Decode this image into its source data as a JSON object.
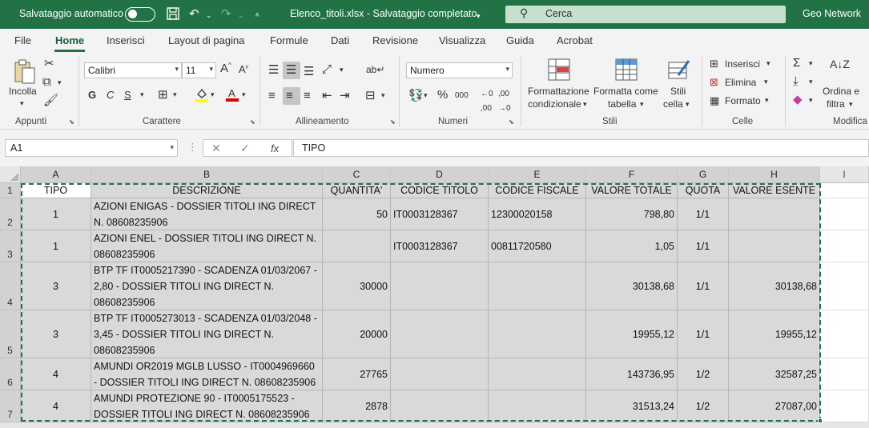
{
  "titlebar": {
    "autosave_label": "Salvataggio automatico",
    "autosave_on": false,
    "filename": "Elenco_titoli.xlsx  -  Salvataggio completato",
    "search_placeholder": "Cerca",
    "user": "Geo Network",
    "icons": [
      "save-icon",
      "undo-icon",
      "redo-icon",
      "customize-qat-icon"
    ]
  },
  "tabs": [
    "File",
    "Home",
    "Inserisci",
    "Layout di pagina",
    "Formule",
    "Dati",
    "Revisione",
    "Visualizza",
    "Guida",
    "Acrobat"
  ],
  "active_tab": "Home",
  "ribbon": {
    "clipboard": {
      "label": "Appunti",
      "paste": "Incolla"
    },
    "font": {
      "label": "Carattere",
      "name": "Calibri",
      "size": "11",
      "bold": "G",
      "italic": "C",
      "underline": "S"
    },
    "alignment": {
      "label": "Allineamento"
    },
    "number": {
      "label": "Numeri",
      "format": "Numero",
      "pct": "%",
      "thousands": "000"
    },
    "styles": {
      "label": "Stili",
      "cond_line1": "Formattazione",
      "cond_line2": "condizionale",
      "table_line1": "Formatta come",
      "table_line2": "tabella",
      "cell_line1": "Stili",
      "cell_line2": "cella"
    },
    "cells": {
      "label": "Celle",
      "insert": "Inserisci",
      "delete": "Elimina",
      "format": "Formato"
    },
    "editing": {
      "label": "Modifica",
      "sort_line1": "Ordina e",
      "sort_line2": "filtra"
    }
  },
  "formula_bar": {
    "cell_ref": "A1",
    "content": "TIPO",
    "fx": "fx"
  },
  "columns": [
    "A",
    "B",
    "C",
    "D",
    "E",
    "F",
    "G",
    "H",
    "I"
  ],
  "rows": [
    "1",
    "2",
    "3",
    "4",
    "5",
    "6",
    "7"
  ],
  "table": {
    "headers": [
      "TIPO",
      "DESCRIZIONE",
      "QUANTITA'",
      "CODICE TITOLO",
      "CODICE FISCALE",
      "VALORE TOTALE",
      "QUOTA",
      "VALORE ESENTE"
    ],
    "data": [
      [
        "1",
        "AZIONI ENIGAS - DOSSIER TITOLI ING DIRECT N. 08608235906",
        "50",
        "IT0003128367",
        "12300020158",
        "798,80",
        "1/1",
        ""
      ],
      [
        "1",
        "AZIONI ENEL - DOSSIER TITOLI ING DIRECT N. 08608235906",
        "",
        "IT0003128367",
        "00811720580",
        "1,05",
        "1/1",
        ""
      ],
      [
        "3",
        "BTP TF IT0005217390 - SCADENZA 01/03/2067 - 2,80 - DOSSIER TITOLI ING DIRECT N. 08608235906",
        "30000",
        "",
        "",
        "30138,68",
        "1/1",
        "30138,68"
      ],
      [
        "3",
        "BTP TF IT0005273013 - SCADENZA 01/03/2048 - 3,45 - DOSSIER TITOLI ING DIRECT N. 08608235906",
        "20000",
        "",
        "",
        "19955,12",
        "1/1",
        "19955,12"
      ],
      [
        "4",
        "AMUNDI OR2019 MGLB LUSSO - IT0004969660 - DOSSIER TITOLI ING DIRECT N. 08608235906",
        "27765",
        "",
        "",
        "143736,95",
        "1/2",
        "32587,25"
      ],
      [
        "4",
        "AMUNDI PROTEZIONE 90 - IT0005175523 - DOSSIER TITOLI ING DIRECT N. 08608235906",
        "2878",
        "",
        "",
        "31513,24",
        "1/2",
        "27087,00"
      ]
    ]
  },
  "colors": {
    "excel_green": "#217346",
    "selection_fill": "#d9d9d9"
  }
}
